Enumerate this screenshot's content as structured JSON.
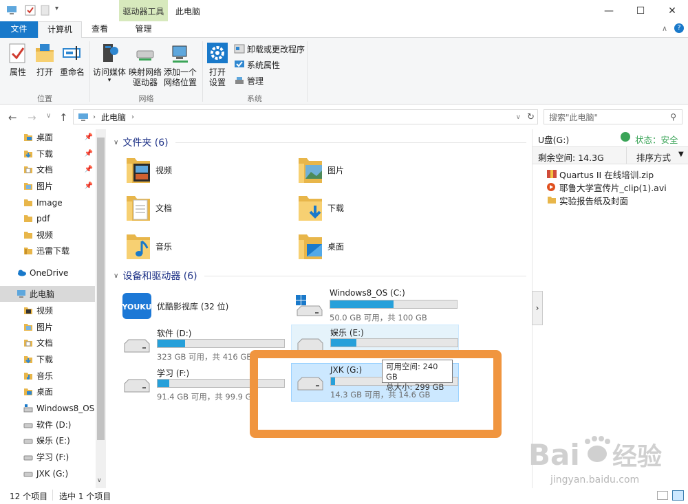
{
  "window": {
    "title": "此电脑",
    "context_group": "驱动器工具"
  },
  "tabs": {
    "file": "文件",
    "computer": "计算机",
    "view": "查看",
    "manage": "管理"
  },
  "ribbon": {
    "location": {
      "label": "位置",
      "properties": "属性",
      "open": "打开",
      "rename": "重命名"
    },
    "network": {
      "label": "网络",
      "access_media": "访问媒体",
      "map_drive_1": "映射网络",
      "map_drive_2": "驱动器",
      "add_location_1": "添加一个",
      "add_location_2": "网络位置"
    },
    "system": {
      "label": "系统",
      "open_settings_1": "打开",
      "open_settings_2": "设置",
      "uninstall": "卸载或更改程序",
      "sys_props": "系统属性",
      "manage": "管理"
    }
  },
  "address": {
    "path": "此电脑",
    "search_placeholder": "搜索\"此电脑\""
  },
  "sidebar": {
    "quick": [
      "桌面",
      "下载",
      "文档",
      "图片",
      "Image",
      "pdf",
      "视频",
      "迅雷下载"
    ],
    "onedrive": "OneDrive",
    "thispc": "此电脑",
    "pc_items": [
      "视频",
      "图片",
      "文档",
      "下载",
      "音乐",
      "桌面",
      "Windows8_OS",
      "软件 (D:)",
      "娱乐 (E:)",
      "学习 (F:)",
      "JXK (G:)"
    ]
  },
  "content": {
    "folders_header": "文件夹 (6)",
    "folders": [
      "视频",
      "图片",
      "文档",
      "下载",
      "音乐",
      "桌面"
    ],
    "devices_header": "设备和驱动器 (6)",
    "youku": "优酷影视库 (32 位)",
    "drives": [
      {
        "name": "Windows8_OS (C:)",
        "info": "50.0 GB 可用，共 100 GB",
        "used_fraction": 0.5
      },
      {
        "name": "软件 (D:)",
        "info": "323 GB 可用，共 416 GB",
        "used_fraction": 0.22
      },
      {
        "name": "娱乐 (E:)",
        "info": "",
        "used_fraction": 0.2
      },
      {
        "name": "学习 (F:)",
        "info": "91.4 GB 可用，共 99.9 GB",
        "used_fraction": 0.09
      },
      {
        "name": "JXK (G:)",
        "info": "14.3 GB 可用，共 14.6 GB",
        "used_fraction": 0.03
      }
    ],
    "tooltip_1": "可用空间: 240 GB",
    "tooltip_2": "总大小: 299 GB"
  },
  "preview": {
    "drive": "U盘(G:)",
    "status": "状态：安全",
    "free": "剩余空间: 14.3G",
    "sort": "排序方式",
    "files": [
      "Quartus II 在线培训.zip",
      "耶鲁大学宣传片_clip(1).avi",
      "实验报告纸及封面"
    ]
  },
  "status": {
    "count": "12 个项目",
    "selected": "选中 1 个项目"
  },
  "watermark": {
    "brand": "Bai 经验",
    "url": "jingyan.baidu.com"
  },
  "colors": {
    "accent": "#1979ca",
    "highlight_box": "#f0953f",
    "bar": "#26a0da",
    "selected_bg": "#cce8ff"
  }
}
